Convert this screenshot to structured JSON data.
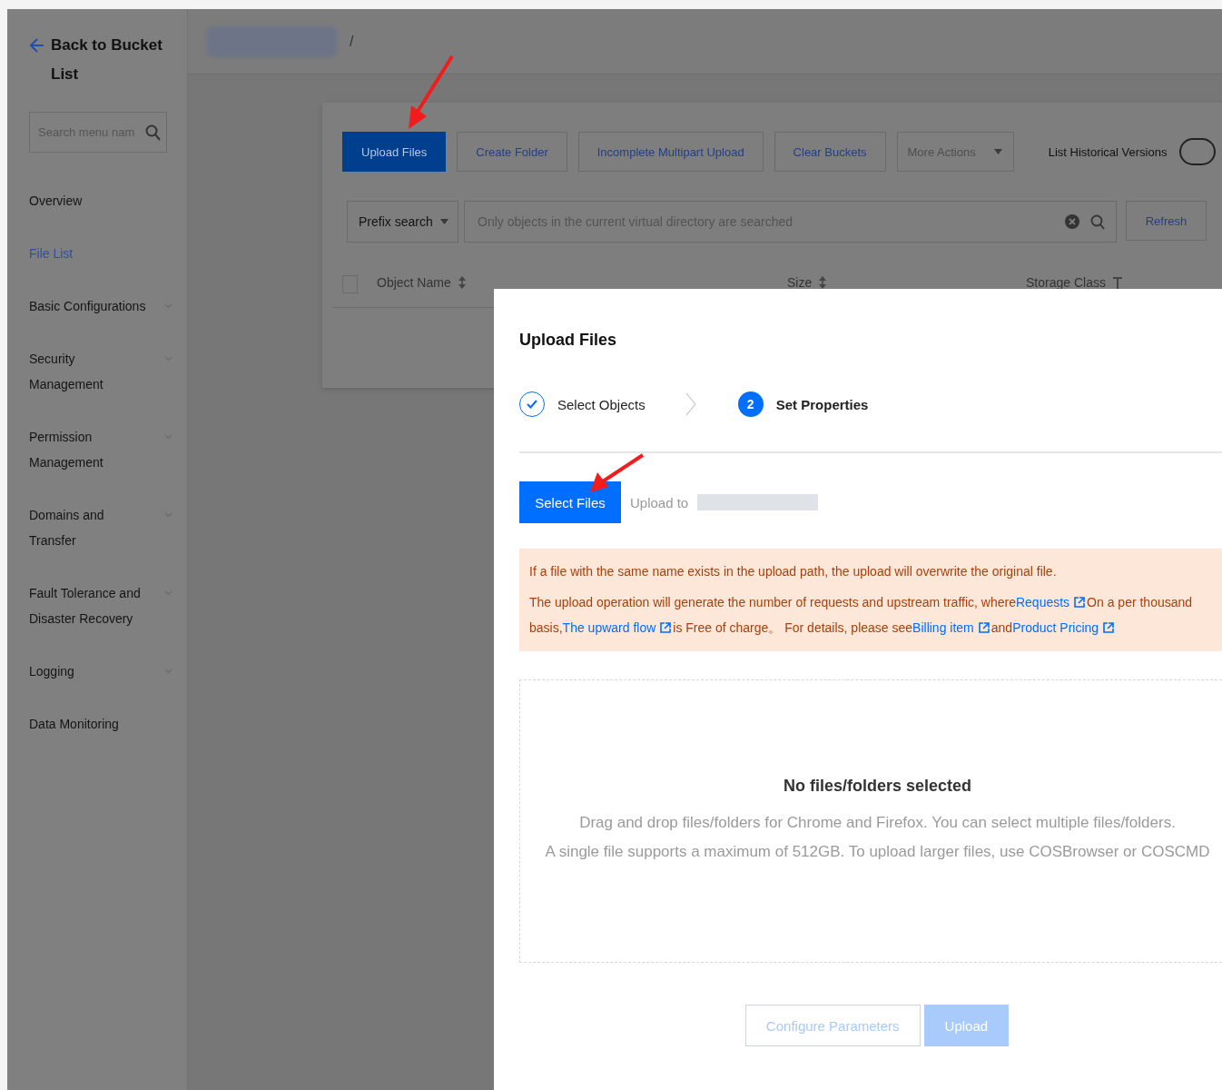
{
  "sidebar": {
    "back_link": "Back to Bucket List",
    "search": {
      "placeholder": "Search menu nam"
    },
    "items": [
      {
        "label": "Overview",
        "selected": false,
        "expandable": false
      },
      {
        "label": "File List",
        "selected": true,
        "expandable": false
      },
      {
        "label": "Basic Configurations",
        "selected": false,
        "expandable": true
      },
      {
        "label": "Security\nManagement",
        "selected": false,
        "expandable": true
      },
      {
        "label": "Permission\nManagement",
        "selected": false,
        "expandable": true
      },
      {
        "label": "Domains and\nTransfer",
        "selected": false,
        "expandable": true
      },
      {
        "label": "Fault Tolerance and\nDisaster Recovery",
        "selected": false,
        "expandable": true
      },
      {
        "label": "Logging",
        "selected": false,
        "expandable": true
      },
      {
        "label": "Data Monitoring",
        "selected": false,
        "expandable": false
      }
    ]
  },
  "header": {
    "breadcrumb_separator": "/"
  },
  "toolbar": {
    "buttons": [
      {
        "label": "Upload Files",
        "kind": "primary"
      },
      {
        "label": "Create Folder",
        "kind": "default"
      },
      {
        "label": "Incomplete Multipart Upload",
        "kind": "default"
      },
      {
        "label": "Clear Buckets",
        "kind": "default"
      },
      {
        "label": "More Actions",
        "kind": "dropdown"
      }
    ],
    "toggle": {
      "label": "List Historical Versions",
      "on": false
    }
  },
  "search_bar": {
    "mode": "Prefix search",
    "placeholder": "Only objects in the current virtual directory are searched",
    "refresh": "Refresh"
  },
  "table": {
    "select_all": {
      "checked": false
    },
    "columns": [
      {
        "label": "Object Name",
        "kind": "sort"
      },
      {
        "label": "Size",
        "kind": "sort"
      },
      {
        "label": "Storage Class",
        "kind": "filter"
      }
    ]
  },
  "modal": {
    "title": "Upload Files",
    "steps": [
      {
        "label": "Select Objects",
        "kind": "done"
      },
      {
        "number": "2",
        "label": "Set Properties",
        "kind": "current"
      }
    ],
    "select_button": "Select Files",
    "upload_to_label": "Upload to",
    "notice": {
      "first": "If a file with the same name exists in the upload path, the upload will overwrite the original file.",
      "second": [
        {
          "kind": "text",
          "text": "The upload operation will generate the number of requests and upstream traffic, where"
        },
        {
          "kind": "link",
          "text": "Requests"
        },
        {
          "kind": "text",
          "text": "On a per thousand basis,"
        },
        {
          "kind": "link",
          "text": "The upward flow"
        },
        {
          "kind": "text",
          "text": "is Free of charge。 For details, please see"
        },
        {
          "kind": "link",
          "text": "Billing item"
        },
        {
          "kind": "text",
          "text": "and"
        },
        {
          "kind": "link",
          "text": "Product Pricing"
        }
      ]
    },
    "dropzone": {
      "title": "No files/folders selected",
      "lines": [
        "Drag and drop files/folders for Chrome and Firefox. You can select multiple files/folders.",
        "A single file supports a maximum of 512GB. To upload larger files, use COSBrowser or COSCMD"
      ]
    },
    "footer_buttons": [
      {
        "label": "Configure Parameters",
        "kind": "secondary",
        "disabled": true
      },
      {
        "label": "Upload",
        "kind": "primary",
        "disabled": true
      }
    ]
  }
}
